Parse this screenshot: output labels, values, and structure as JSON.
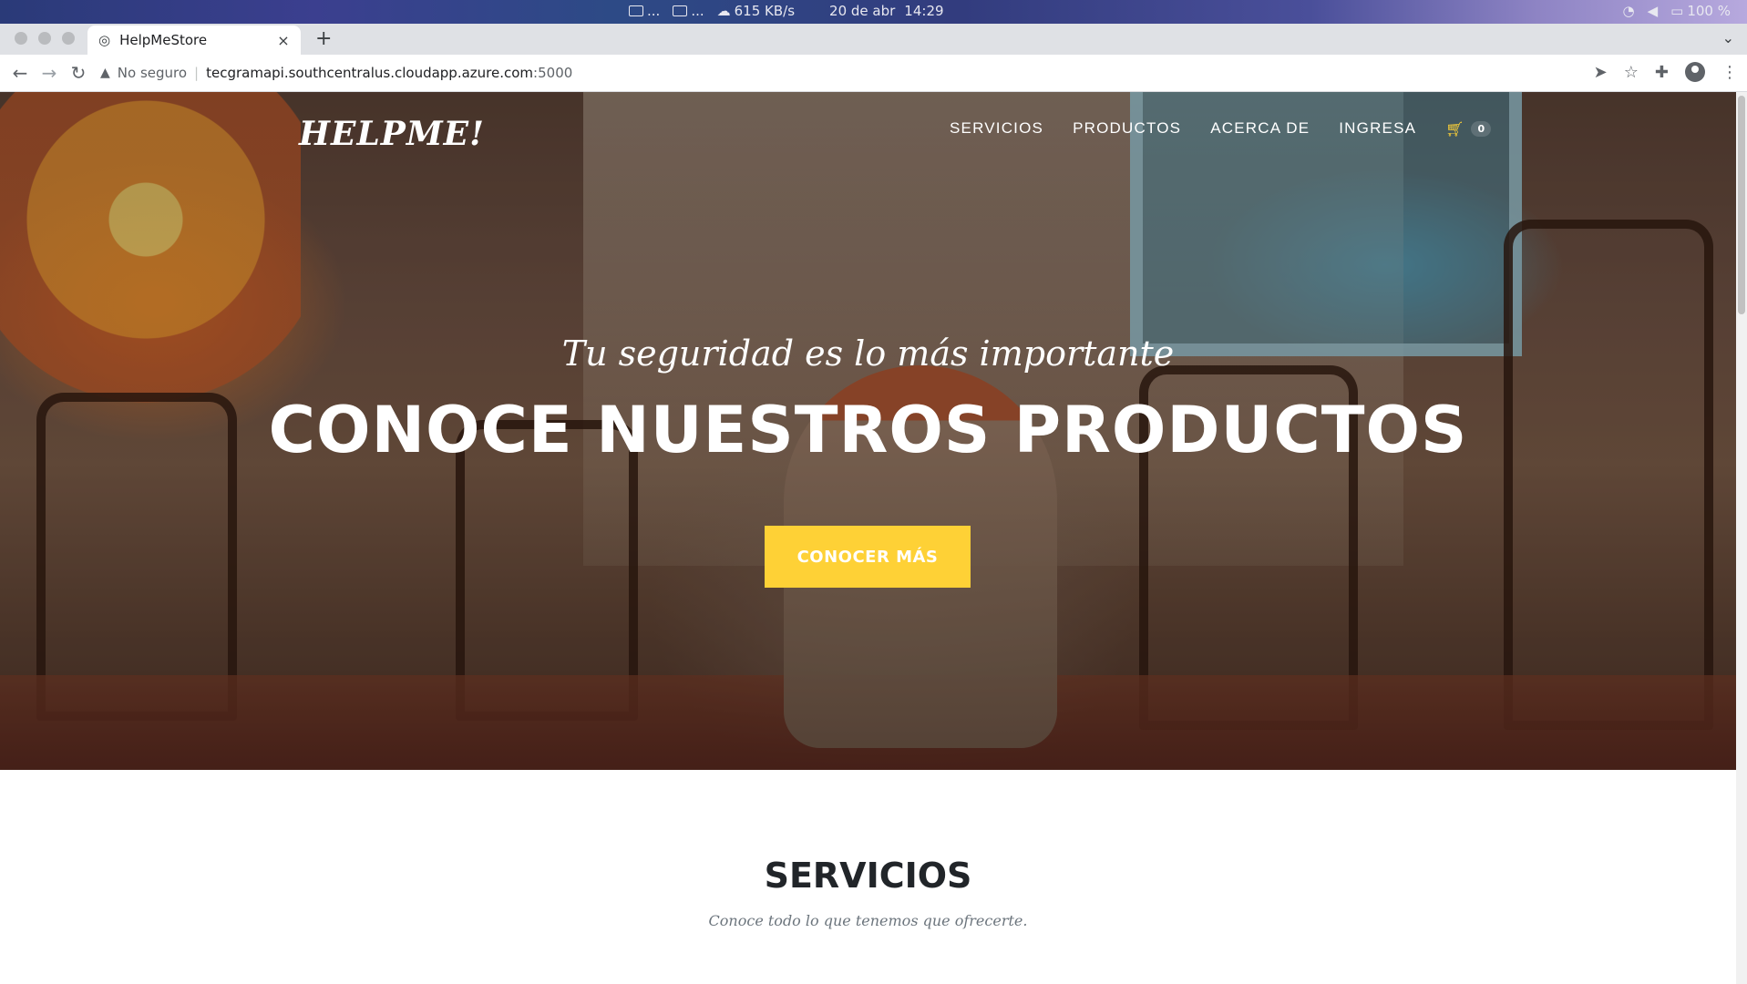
{
  "os_bar": {
    "network_speed": "615 KB/s",
    "date": "20 de abr",
    "time": "14:29",
    "battery": "100 %",
    "overflow1": "...",
    "overflow2": "..."
  },
  "browser": {
    "tab_title": "HelpMeStore",
    "tab_close": "×",
    "new_tab": "+",
    "security_label": "No seguro",
    "url_host": "tecgramapi.southcentralus.cloudapp.azure.com",
    "url_port": ":5000"
  },
  "site": {
    "brand": "HELPME!",
    "nav": {
      "servicios": "SERVICIOS",
      "productos": "PRODUCTOS",
      "acerca": "ACERCA DE",
      "ingresa": "INGRESA"
    },
    "cart_count": "0",
    "accent_color": "#fed136",
    "hero": {
      "subtitle": "Tu seguridad es lo más importante",
      "title": "CONOCE NUESTROS PRODUCTOS",
      "button": "CONOCER MÁS"
    },
    "services": {
      "title": "SERVICIOS",
      "subtitle": "Conoce todo lo que tenemos que ofrecerte."
    }
  },
  "icons": [
    "wifi-icon",
    "volume-icon",
    "battery-icon",
    "globe-icon",
    "back-icon",
    "forward-icon",
    "reload-icon",
    "warning-icon",
    "send-icon",
    "star-icon",
    "extensions-icon",
    "profile-icon",
    "menu-icon",
    "cart-icon"
  ]
}
